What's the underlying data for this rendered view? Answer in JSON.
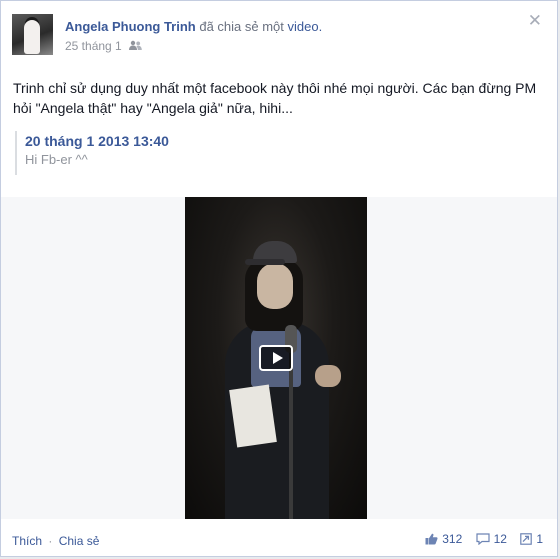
{
  "post": {
    "author": "Angela Phuong Trinh",
    "action_prefix": "đã chia sẻ một",
    "action_object": "video.",
    "date": "25 tháng 1",
    "text": "Trinh chỉ sử dụng duy nhất một facebook này thôi nhé mọi người. Các bạn đừng PM hỏi \"Angela thật\" hay \"Angela giả\" nữa, hihi...",
    "close_symbol": "✕",
    "audience_icon": "friends-icon"
  },
  "shared": {
    "date": "20 tháng 1 2013 13:40",
    "text": "Hi Fb-er ^^"
  },
  "video": {
    "play_icon": "play-icon"
  },
  "footer": {
    "like": "Thích",
    "separator": "·",
    "share": "Chia sẻ",
    "likes_count": "312",
    "comments_count": "12",
    "shares_count": "1",
    "icons": [
      "thumbs-up-icon",
      "comment-icon",
      "share-icon"
    ]
  },
  "colors": {
    "link": "#3b5998",
    "meta": "#90949c",
    "border": "#c4cde0"
  }
}
